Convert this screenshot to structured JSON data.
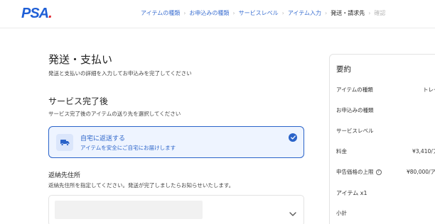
{
  "header": {
    "logo": {
      "main": "PSA",
      "accent": "."
    },
    "steps": [
      {
        "label": "アイテムの種類",
        "state": "link"
      },
      {
        "label": "お申込みの種類",
        "state": "link"
      },
      {
        "label": "サービスレベル",
        "state": "link"
      },
      {
        "label": "アイテム入力",
        "state": "link"
      },
      {
        "label": "発送・請求先",
        "state": "current"
      },
      {
        "label": "確認",
        "state": "disabled"
      }
    ],
    "separator": "›"
  },
  "main": {
    "title": "発送・支払い",
    "subtitle": "発送と支払いの詳細を入力してお申込みを完了してください",
    "completion": {
      "title": "サービス完了後",
      "subtitle": "サービス完了後のアイテムの送り先を選択してください",
      "option": {
        "title": "自宅に返送する",
        "description": "アイテムを安全にご自宅にお届けします",
        "selected": true
      }
    },
    "return_address": {
      "title": "返納先住所",
      "subtitle": "返納先住所を指定してください。発送が完了しましたらお知らせいたします。"
    }
  },
  "summary": {
    "title": "要約",
    "rows": [
      {
        "label": "アイテムの種類",
        "value": "トレー"
      },
      {
        "label": "お申込みの種類",
        "value": ""
      },
      {
        "label": "サービスレベル",
        "value": ""
      },
      {
        "label": "料金",
        "value": "¥3,410/ア"
      },
      {
        "label": "申告価格の上限",
        "value": "¥80,000/ア",
        "info": "?"
      },
      {
        "label": "アイテム x1",
        "value": ""
      },
      {
        "label": "小計",
        "value": ""
      }
    ]
  },
  "colors": {
    "accent": "#2a63c9",
    "selected_bg": "#eef4ff",
    "logo_blue": "#1f5fd6",
    "logo_red": "#e0222c"
  },
  "icons": {
    "option": "truck-icon",
    "selected": "check-circle-icon",
    "dropdown": "chevron-down-icon",
    "info": "info-icon"
  }
}
